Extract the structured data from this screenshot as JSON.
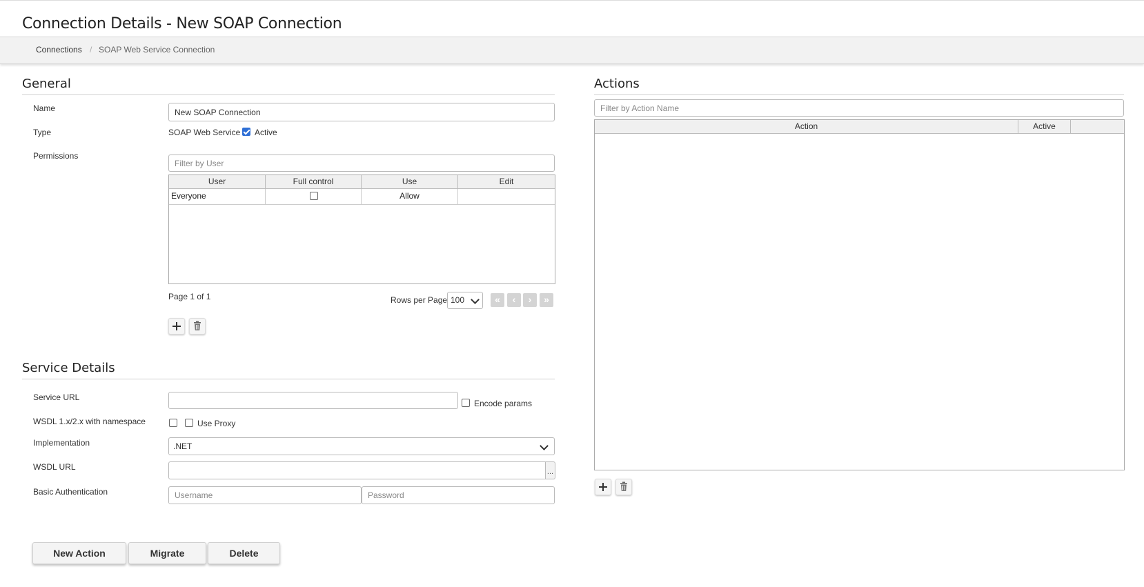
{
  "page": {
    "title": "Connection Details - New SOAP Connection"
  },
  "breadcrumb": {
    "items": [
      "Connections",
      "SOAP Web Service Connection"
    ],
    "separator": "/"
  },
  "general": {
    "title": "General",
    "name_label": "Name",
    "name_value": "New SOAP Connection",
    "type_label": "Type",
    "type_value": "SOAP Web Service",
    "active_label": "Active",
    "active_checked": true,
    "permissions_label": "Permissions",
    "filter_placeholder": "Filter by User",
    "columns": [
      "User",
      "Full control",
      "Use",
      "Edit"
    ],
    "rows": [
      {
        "user": "Everyone",
        "full_control": false,
        "use": "Allow",
        "edit": ""
      }
    ],
    "page_info": "Page 1 of 1",
    "rows_per_page_label": "Rows per Page",
    "rows_per_page_value": "100"
  },
  "service": {
    "title": "Service Details",
    "service_url_label": "Service URL",
    "service_url_value": "",
    "encode_params_label": "Encode params",
    "wsdl_label": "WSDL 1.x/2.x with namespace",
    "use_proxy_label": "Use Proxy",
    "implementation_label": "Implementation",
    "implementation_value": ".NET",
    "wsdl_url_label": "WSDL URL",
    "wsdl_url_value": "",
    "ellipsis": "...",
    "basic_auth_label": "Basic Authentication",
    "username_placeholder": "Username",
    "password_placeholder": "Password"
  },
  "actions": {
    "title": "Actions",
    "filter_placeholder": "Filter by Action Name",
    "columns": [
      "Action",
      "Active",
      ""
    ]
  },
  "buttons": {
    "new_action": "New Action",
    "migrate": "Migrate",
    "delete": "Delete"
  },
  "icons": {
    "add": "plus-icon",
    "delete": "trash-icon",
    "first": "double-chevron-left-icon",
    "prev": "chevron-left-icon",
    "next": "chevron-right-icon",
    "last": "double-chevron-right-icon"
  }
}
